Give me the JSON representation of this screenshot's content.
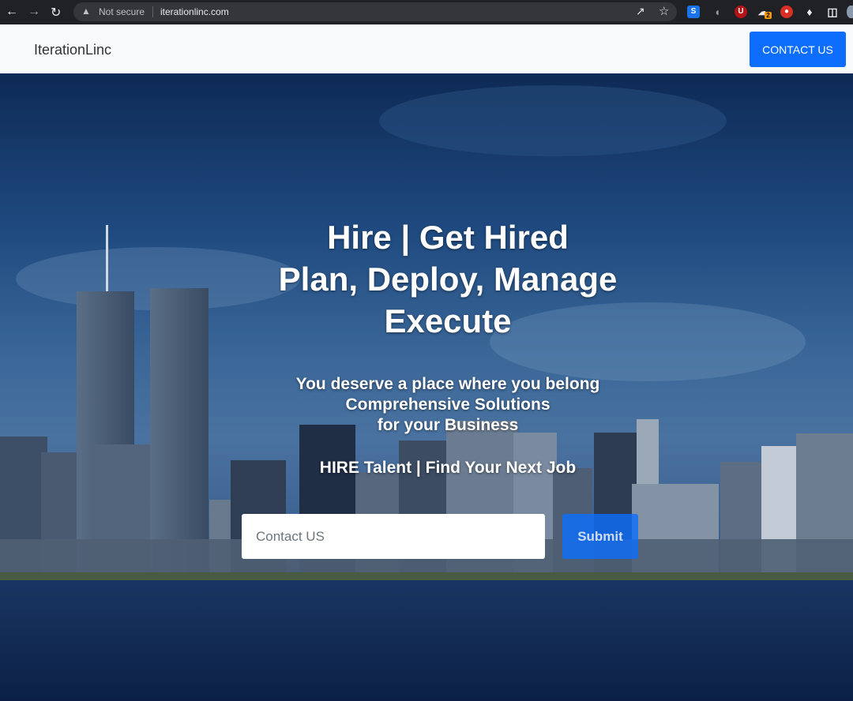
{
  "browser": {
    "security_label": "Not secure",
    "url": "iterationlinc.com",
    "extension_badge": "2"
  },
  "navbar": {
    "brand": "IterationLinc",
    "contact_button": "CONTACT US"
  },
  "hero": {
    "heading_lines": [
      "Hire | Get Hired",
      "Plan, Deploy, Manage",
      "Execute"
    ],
    "subheading_lines": [
      "You deserve a place where you belong",
      "Comprehensive Solutions",
      "for your Business"
    ],
    "tagline": "HIRE Talent | Find Your Next Job",
    "input_placeholder": "Contact US",
    "submit_label": "Submit"
  }
}
